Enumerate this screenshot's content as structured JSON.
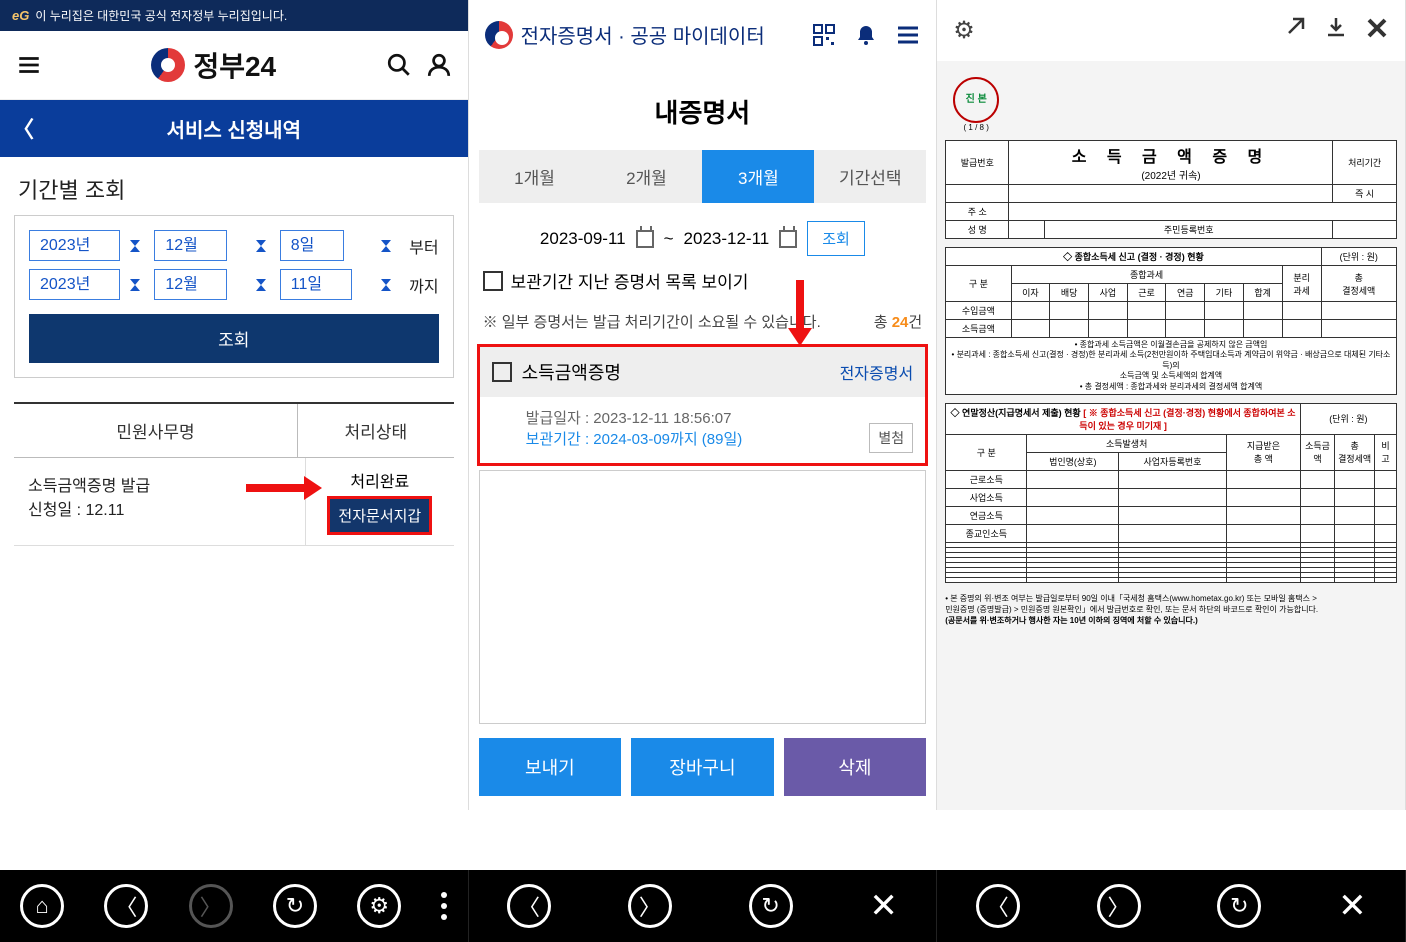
{
  "pane1": {
    "banner": "이 누리집은 대한민국 공식 전자정부 누리집입니다.",
    "eg": "eG",
    "logo": "정부24",
    "title": "서비스 신청내역",
    "section": "기간별 조회",
    "from": {
      "y": "2023년",
      "m": "12월",
      "d": "8일",
      "lbl": "부터"
    },
    "to": {
      "y": "2023년",
      "m": "12월",
      "d": "11일",
      "lbl": "까지"
    },
    "query": "조회",
    "th1": "민원사무명",
    "th2": "처리상태",
    "row_name": "소득금액증명 발급",
    "row_date": "신청일 : 12.11",
    "status": "처리완료",
    "wallet": "전자문서지갑"
  },
  "pane2": {
    "logo": "전자증명서 · 공공 마이데이터",
    "title": "내증명서",
    "tabs": [
      "1개월",
      "2개월",
      "3개월",
      "기간선택"
    ],
    "range_from": "2023-09-11",
    "tilde": "~",
    "range_to": "2023-12-11",
    "query": "조회",
    "chk": "보관기간 지난 증명서 목록 보이기",
    "note": "※ 일부 증명서는 발급 처리기간이 소요될 수 있습니다.",
    "count_lbl": "총 ",
    "count": "24",
    "count_suf": "건",
    "cert_name": "소득금액증명",
    "cert_badge": "전자증명서",
    "issued_lbl": "발급일자 : ",
    "issued": "2023-12-11 18:56:07",
    "keep_lbl": "보관기간 : ",
    "keep": "2024-03-09까지 (89일)",
    "attach": "별첨",
    "btn_send": "보내기",
    "btn_cart": "장바구니",
    "btn_del": "삭제"
  },
  "pane3": {
    "seal": "진 본",
    "seal_no": "( 1 / 8 )",
    "title": "소 득 금 액 증 명",
    "sub": "(2022년 귀속)",
    "h_issue": "발급번호",
    "h_proc": "처리기간",
    "h_proc_v": "즉 시",
    "h_addr": "주  소",
    "h_name": "성  명",
    "h_rrn": "주민등록번호",
    "sec1": "◇ 종합소득세 신고 (결정 · 경정) 현황",
    "unit": "(단위 : 원)",
    "r_gubun": "구  분",
    "r_tax": "종합과세",
    "r_cols": [
      "이자",
      "배당",
      "사업",
      "근로",
      "연금",
      "기타",
      "합계"
    ],
    "r_sep": "분리\n과세",
    "r_final": "총\n결정세액",
    "r_income": "수입금액",
    "r_amount": "소득금액",
    "note1": "• 종합과세 소득금액은 이월결손금을 공제하지 않은 금액임",
    "note2": "• 분리과세 : 종합소득세 신고(결정 · 경정)한 분리과세 소득(2천만원이하 주택임대소득과 계약금이 위약금 · 배상금으로 대체된 기타소득)의\n  소득금액 및 소득세액의 합계액",
    "note3": "• 총 결정세액 : 종합과세와 분리과세의 결정세액 합계액",
    "sec2": "◇ 연말정산(지급명세서 제출) 현황",
    "sec2_red": "[ ※ 종합소득세 신고 (결정·경정) 현황에서 종합하여본 소득이 있는 경우 미기재 ]",
    "t2_gubun": "구  분",
    "t2_src": "소득발생처",
    "t2_corp": "법인명(상호)",
    "t2_biz": "사업자등록번호",
    "t2_pay": "지급받은\n총 액",
    "t2_inc": "소득금액",
    "t2_tax": "총\n결정세액",
    "t2_note": "비고",
    "rows2": [
      "근로소득",
      "사업소득",
      "연금소득",
      "종교인소득"
    ],
    "foot1": "• 본 증명의 위·변조 여부는 발급일로부터 90일 이내「국세청 홈택스(www.hometax.go.kr) 또는 모바일 홈택스 >",
    "foot2": "  민원증명 (증명발급) > 민원증명 원본확인」에서 발급번호로 확인, 또는 문서 하단의 바코드로 확인이 가능합니다.",
    "foot3": "(공문서를 위·변조하거나 행사한 자는 10년 이하의 징역에 처할 수 있습니다.)"
  }
}
